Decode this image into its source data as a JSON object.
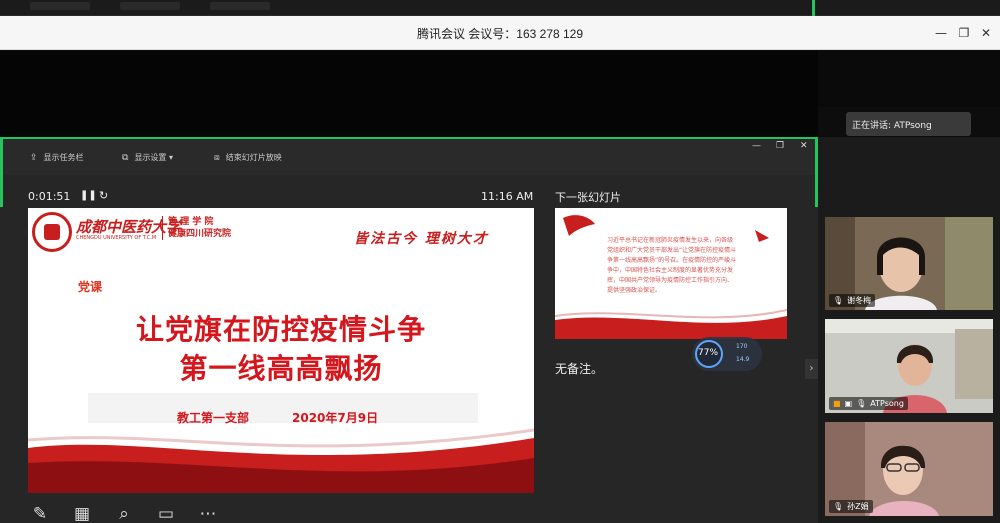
{
  "window": {
    "title": "腾讯会议  会议号：163 278 129"
  },
  "presenter_toolbar": {
    "show_taskbar": "显示任务栏",
    "display_settings": "显示设置 ▾",
    "end_show": "结束幻灯片放映"
  },
  "presenter": {
    "elapsed": "0:01:51",
    "pause_icon": "pause-icon",
    "clock": "11:16 AM",
    "next_slide_label": "下一张幻灯片",
    "notes": "无备注。"
  },
  "current_slide": {
    "university_cn": "成都中医药大学",
    "university_en": "CHENGDU UNIVERSITY OF T.C.M",
    "institute_line1": "管 理 学 院",
    "institute_line2": "健康四川研究院",
    "motto": "皆法古今 理树大才",
    "tag": "党课",
    "headline_line1": "让党旗在防控疫情斗争",
    "headline_line2": "第一线高高飘扬",
    "branch": "教工第一支部",
    "date": "2020年7月9日"
  },
  "next_slide": {
    "body": "习近平总书记在新冠肺炎疫情发生以来，向各级党组织和广大党员干部发出“让党旗在防控疫情斗争第一线高高飘扬”的号召。在疫情防控的严峻斗争中，中国特色社会主义制度的显著优势充分发挥，中国共产党领导为疫情防控工作指引方向、提供坚强政治保证。"
  },
  "net_badge": {
    "percent": "77%",
    "up": "170",
    "down": "14.9"
  },
  "right_panel": {
    "speaking": "正在讲话: ATPsong"
  },
  "participants": [
    {
      "name": "谢冬梅"
    },
    {
      "name": "ATPsong"
    },
    {
      "name": "孙Z娟"
    }
  ],
  "colors": {
    "accent_green": "#22c55e",
    "slide_red": "#d5171d"
  }
}
